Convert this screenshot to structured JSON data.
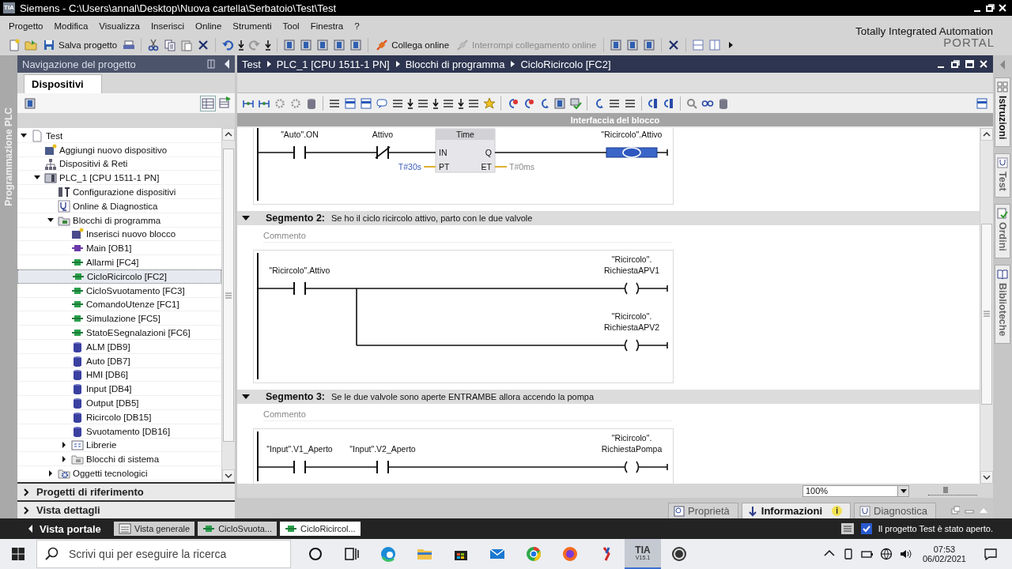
{
  "window": {
    "logo": "TIA",
    "title": "Siemens  -  C:\\Users\\annal\\Desktop\\Nuova cartella\\Serbatoio\\Test\\Test"
  },
  "menu": [
    "Progetto",
    "Modifica",
    "Visualizza",
    "Inserisci",
    "Online",
    "Strumenti",
    "Tool",
    "Finestra",
    "?"
  ],
  "toolbar_buttons": [
    {
      "label": "Salva progetto",
      "disabled": false
    },
    {
      "label": "Collega online",
      "disabled": false
    },
    {
      "label": "Interrompi collegamento online",
      "disabled": true
    }
  ],
  "brand": {
    "title": "Totally Integrated Automation",
    "subtitle": "PORTAL"
  },
  "side_strip": {
    "label": "Programmazione PLC"
  },
  "navigator": {
    "title": "Navigazione del progetto",
    "tab": "Dispositivi",
    "tree": [
      {
        "label": "Test",
        "kind": "project",
        "expanded": true,
        "selected": false,
        "children": [
          {
            "label": "Aggiungi nuovo dispositivo",
            "kind": "add_device",
            "selected": false
          },
          {
            "label": "Dispositivi & Reti",
            "kind": "network",
            "selected": false
          },
          {
            "label": "PLC_1 [CPU 1511-1 PN]",
            "kind": "plc",
            "expanded": true,
            "selected": false,
            "children": [
              {
                "label": "Configurazione dispositivi",
                "kind": "config",
                "selected": false
              },
              {
                "label": "Online & Diagnostica",
                "kind": "diagnostics",
                "selected": false
              },
              {
                "label": "Blocchi di programma",
                "kind": "folder",
                "expanded": true,
                "selected": false,
                "children": [
                  {
                    "label": "Inserisci nuovo blocco",
                    "kind": "add_block",
                    "selected": false
                  },
                  {
                    "label": "Main [OB1]",
                    "kind": "ob",
                    "selected": false
                  },
                  {
                    "label": "Allarmi [FC4]",
                    "kind": "fc",
                    "selected": false
                  },
                  {
                    "label": "CicloRicircolo [FC2]",
                    "kind": "fc",
                    "selected": true
                  },
                  {
                    "label": "CicloSvuotamento [FC3]",
                    "kind": "fc",
                    "selected": false
                  },
                  {
                    "label": "ComandoUtenze [FC1]",
                    "kind": "fc",
                    "selected": false
                  },
                  {
                    "label": "Simulazione [FC5]",
                    "kind": "fc",
                    "selected": false
                  },
                  {
                    "label": "StatoESegnalazioni [FC6]",
                    "kind": "fc",
                    "selected": false
                  },
                  {
                    "label": "ALM [DB9]",
                    "kind": "db",
                    "selected": false
                  },
                  {
                    "label": "Auto [DB7]",
                    "kind": "db",
                    "selected": false
                  },
                  {
                    "label": "HMI [DB6]",
                    "kind": "db",
                    "selected": false
                  },
                  {
                    "label": "Input [DB4]",
                    "kind": "db",
                    "selected": false
                  },
                  {
                    "label": "Output [DB5]",
                    "kind": "db",
                    "selected": false
                  },
                  {
                    "label": "Ricircolo [DB15]",
                    "kind": "db",
                    "selected": false
                  },
                  {
                    "label": "Svuotamento [DB16]",
                    "kind": "db",
                    "selected": false
                  },
                  {
                    "label": "Librerie",
                    "kind": "library",
                    "expanded": false,
                    "selected": false
                  },
                  {
                    "label": "Blocchi di sistema",
                    "kind": "system",
                    "expanded": false,
                    "selected": false
                  }
                ]
              },
              {
                "label": "Oggetti tecnologici",
                "kind": "technology",
                "expanded": false,
                "selected": false
              }
            ]
          }
        ]
      }
    ],
    "sections": [
      {
        "label": "Progetti di riferimento",
        "expanded": false
      },
      {
        "label": "Vista dettagli",
        "expanded": false
      }
    ]
  },
  "editor": {
    "breadcrumb": [
      "Test",
      "PLC_1 [CPU 1511-1 PN]",
      "Blocchi di programma",
      "CicloRicircolo [FC2]"
    ],
    "interface_bar": "Interfaccia del blocco",
    "segments": [
      {
        "rungs": [
          {
            "elements": [
              {
                "kind": "contact_no",
                "operand": [
                  "\"Auto\".ON"
                ],
                "selected": false
              },
              {
                "kind": "contact_nc",
                "operand": [
                  "Attivo"
                ],
                "selected": false
              },
              {
                "kind": "timer",
                "title": "Time",
                "pins": [
                  "IN",
                  "Q",
                  "PT",
                  "ET"
                ],
                "preset": "T#30s",
                "elapsed": "T#0ms",
                "selected": false
              },
              {
                "kind": "coil",
                "operand": [
                  "\"Ricircolo\".Attivo"
                ],
                "selected": true
              }
            ]
          }
        ]
      },
      {
        "label": "Segmento 2:",
        "title": "Se ho il ciclo ricircolo attivo, parto con le due valvole",
        "comment": "Commento",
        "expanded": true,
        "rungs": [
          {
            "elements": [
              {
                "kind": "contact_no",
                "operand": [
                  "\"Ricircolo\".Attivo"
                ],
                "selected": false
              },
              {
                "kind": "coil",
                "operand": [
                  "\"Ricircolo\".",
                  "RichiestaAPV1"
                ],
                "selected": false
              }
            ]
          },
          {
            "branch": true,
            "elements": [
              {
                "kind": "coil",
                "operand": [
                  "\"Ricircolo\".",
                  "RichiestaAPV2"
                ],
                "selected": false
              }
            ]
          }
        ]
      },
      {
        "label": "Segmento 3:",
        "title": "Se le due valvole sono aperte ENTRAMBE allora accendo la pompa",
        "comment": "Commento",
        "expanded": true,
        "rungs": [
          {
            "elements": [
              {
                "kind": "contact_no",
                "operand": [
                  "\"Input\".V1_Aperto"
                ],
                "selected": false
              },
              {
                "kind": "contact_no",
                "operand": [
                  "\"Input\".V2_Aperto"
                ],
                "selected": false
              },
              {
                "kind": "coil",
                "operand": [
                  "\"Ricircolo\".",
                  "RichiestaPompa"
                ],
                "selected": false
              }
            ]
          }
        ]
      }
    ],
    "zoom": {
      "value": "100%",
      "level": 0.35
    }
  },
  "right_tabs": [
    {
      "label": "Istruzioni",
      "kind": "grid",
      "selected": true
    },
    {
      "label": "Test",
      "kind": "stethoscope",
      "selected": false
    },
    {
      "label": "Ordini",
      "kind": "tasks",
      "selected": false
    },
    {
      "label": "Biblioteche",
      "kind": "book",
      "selected": false
    }
  ],
  "inspector_tabs": [
    {
      "label": "Proprietà",
      "kind": "properties",
      "selected": false
    },
    {
      "label": "Informazioni",
      "kind": "info",
      "selected": true,
      "badge": "i"
    },
    {
      "label": "Diagnostica",
      "kind": "diagnostics",
      "selected": false
    }
  ],
  "portal_bar": {
    "portal_view": "Vista portale",
    "editors": [
      {
        "label": "Vista generale",
        "kind": "overview",
        "selected": false
      },
      {
        "label": "CicloSvuota...",
        "kind": "block",
        "selected": false
      },
      {
        "label": "CicloRicircol...",
        "kind": "block",
        "selected": true
      }
    ],
    "status": "Il progetto Test è stato aperto."
  },
  "taskbar": {
    "search_placeholder": "Scrivi qui per eseguire la ricerca",
    "apps": [
      {
        "kind": "cortana"
      },
      {
        "kind": "taskview"
      },
      {
        "kind": "browser"
      },
      {
        "kind": "folder"
      },
      {
        "kind": "store"
      },
      {
        "kind": "mail"
      },
      {
        "kind": "chrome"
      },
      {
        "kind": "firefox"
      },
      {
        "kind": "tool"
      },
      {
        "kind": "tia",
        "label": "TIA",
        "version": "V15.1"
      },
      {
        "kind": "recorder"
      }
    ],
    "time": "07:53",
    "date": "06/02/2021"
  }
}
